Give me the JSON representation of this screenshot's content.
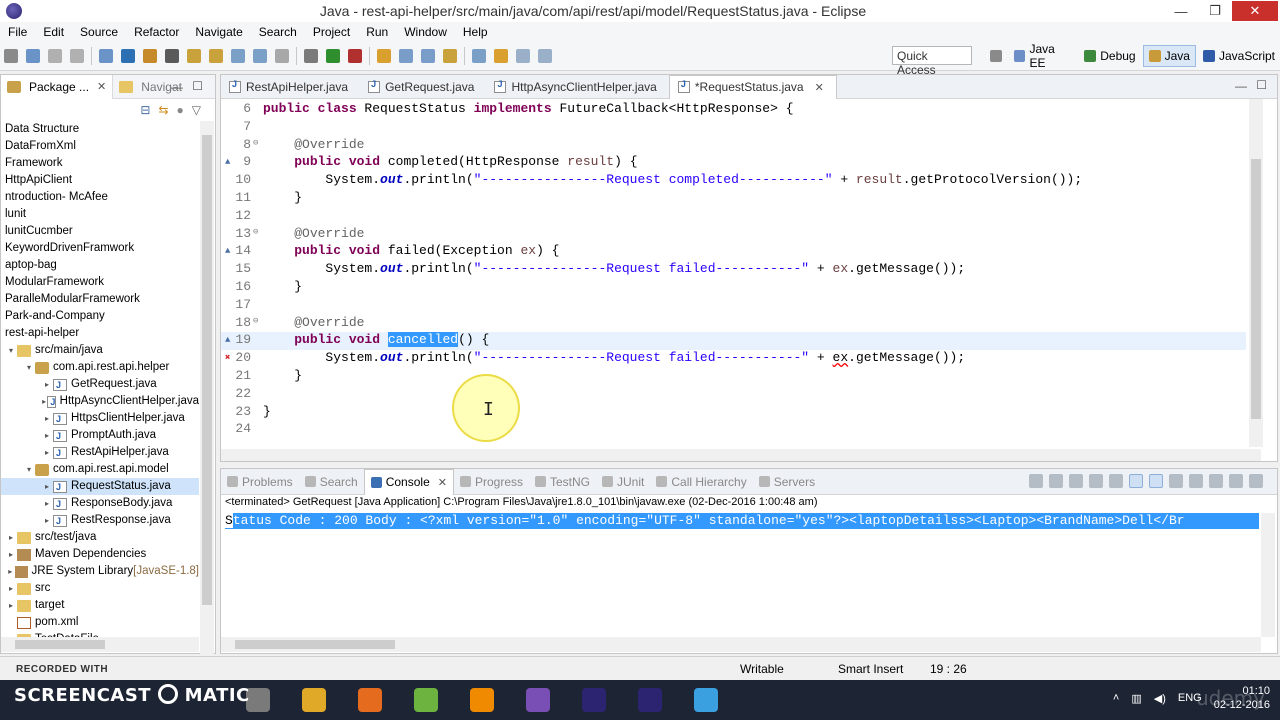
{
  "window": {
    "title": "Java - rest-api-helper/src/main/java/com/api/rest/api/model/RequestStatus.java - Eclipse",
    "minimize": "—",
    "restore": "❐",
    "close": "✕"
  },
  "menu": [
    "File",
    "Edit",
    "Source",
    "Refactor",
    "Navigate",
    "Search",
    "Project",
    "Run",
    "Window",
    "Help"
  ],
  "toolbar": {
    "quick_access": "Quick Access",
    "perspectives": [
      {
        "label": "Java EE",
        "color": "#6d8fc7"
      },
      {
        "label": "Debug",
        "color": "#3d8a3d"
      },
      {
        "label": "Java",
        "color": "#c89a3a",
        "active": true
      },
      {
        "label": "JavaScript",
        "color": "#2f5aa8"
      }
    ]
  },
  "left_pane": {
    "tabs": [
      "Package ...",
      "Navigat"
    ],
    "tree": [
      {
        "label": "Data Structure",
        "indent": 0,
        "icon": "none"
      },
      {
        "label": "DataFromXml",
        "indent": 0,
        "icon": "none"
      },
      {
        "label": "Framework",
        "indent": 0,
        "icon": "none"
      },
      {
        "label": "HttpApiClient",
        "indent": 0,
        "icon": "none"
      },
      {
        "label": "ntroduction- McAfee",
        "indent": 0,
        "icon": "none"
      },
      {
        "label": "lunit",
        "indent": 0,
        "icon": "none"
      },
      {
        "label": "lunitCucmber",
        "indent": 0,
        "icon": "none"
      },
      {
        "label": "KeywordDrivenFramwork",
        "indent": 0,
        "icon": "none"
      },
      {
        "label": "aptop-bag",
        "indent": 0,
        "icon": "none"
      },
      {
        "label": "ModularFramework",
        "indent": 0,
        "icon": "none"
      },
      {
        "label": "ParalleModularFramework",
        "indent": 0,
        "icon": "none"
      },
      {
        "label": "Park-and-Company",
        "indent": 0,
        "icon": "none"
      },
      {
        "label": "rest-api-helper",
        "indent": 0,
        "icon": "none"
      },
      {
        "label": "src/main/java",
        "indent": 1,
        "icon": "folder",
        "arrow": "▾"
      },
      {
        "label": "com.api.rest.api.helper",
        "indent": 2,
        "icon": "pkg",
        "arrow": "▾"
      },
      {
        "label": "GetRequest.java",
        "indent": 3,
        "icon": "java",
        "arrow": "▸"
      },
      {
        "label": "HttpAsyncClientHelper.java",
        "indent": 3,
        "icon": "java",
        "arrow": "▸"
      },
      {
        "label": "HttpsClientHelper.java",
        "indent": 3,
        "icon": "java",
        "arrow": "▸"
      },
      {
        "label": "PromptAuth.java",
        "indent": 3,
        "icon": "java",
        "arrow": "▸"
      },
      {
        "label": "RestApiHelper.java",
        "indent": 3,
        "icon": "java",
        "arrow": "▸"
      },
      {
        "label": "com.api.rest.api.model",
        "indent": 2,
        "icon": "pkg",
        "arrow": "▾"
      },
      {
        "label": "RequestStatus.java",
        "indent": 3,
        "icon": "java",
        "arrow": "▸",
        "selected": true
      },
      {
        "label": "ResponseBody.java",
        "indent": 3,
        "icon": "java",
        "arrow": "▸"
      },
      {
        "label": "RestResponse.java",
        "indent": 3,
        "icon": "java",
        "arrow": "▸"
      },
      {
        "label": "src/test/java",
        "indent": 1,
        "icon": "folder",
        "arrow": "▸"
      },
      {
        "label": "Maven Dependencies",
        "indent": 1,
        "icon": "lib",
        "arrow": "▸"
      },
      {
        "label": "JRE System Library",
        "suffix": " [JavaSE-1.8]",
        "indent": 1,
        "icon": "lib",
        "arrow": "▸"
      },
      {
        "label": "src",
        "indent": 1,
        "icon": "folder",
        "arrow": "▸"
      },
      {
        "label": "target",
        "indent": 1,
        "icon": "folder",
        "arrow": "▸"
      },
      {
        "label": "pom.xml",
        "indent": 1,
        "icon": "xml",
        "arrow": ""
      },
      {
        "label": "TestDataFile",
        "indent": 1,
        "icon": "folder",
        "arrow": ""
      }
    ]
  },
  "editor": {
    "tabs": [
      {
        "label": "RestApiHelper.java"
      },
      {
        "label": "GetRequest.java"
      },
      {
        "label": "HttpAsyncClientHelper.java"
      },
      {
        "label": "*RequestStatus.java",
        "active": true
      }
    ],
    "lines": [
      {
        "n": "6",
        "src": [
          [
            "kw",
            "public "
          ],
          [
            "kw",
            "class "
          ],
          [
            "",
            "RequestStatus "
          ],
          [
            "kw",
            "implements "
          ],
          [
            "",
            "FutureCallback<HttpResponse> {"
          ]
        ]
      },
      {
        "n": "7",
        "src": []
      },
      {
        "n": "8",
        "fold": "⊖",
        "src": [
          [
            "",
            "    "
          ],
          [
            "an",
            "@Override"
          ]
        ]
      },
      {
        "n": "9",
        "ann": "▲",
        "src": [
          [
            "",
            "    "
          ],
          [
            "kw",
            "public "
          ],
          [
            "kw",
            "void "
          ],
          [
            "",
            "completed(HttpResponse "
          ],
          [
            "par",
            "result"
          ],
          [
            "",
            ") {"
          ]
        ]
      },
      {
        "n": "10",
        "src": [
          [
            "",
            "        System."
          ],
          [
            "fld",
            "out"
          ],
          [
            "",
            ".println("
          ],
          [
            "str",
            "\"----------------Request completed-----------\""
          ],
          [
            "",
            " + "
          ],
          [
            "par",
            "result"
          ],
          [
            "",
            ".getProtocolVersion());"
          ]
        ]
      },
      {
        "n": "11",
        "src": [
          [
            "",
            "    }"
          ]
        ]
      },
      {
        "n": "12",
        "src": []
      },
      {
        "n": "13",
        "fold": "⊖",
        "src": [
          [
            "",
            "    "
          ],
          [
            "an",
            "@Override"
          ]
        ]
      },
      {
        "n": "14",
        "ann": "▲",
        "src": [
          [
            "",
            "    "
          ],
          [
            "kw",
            "public "
          ],
          [
            "kw",
            "void "
          ],
          [
            "",
            "failed(Exception "
          ],
          [
            "par",
            "ex"
          ],
          [
            "",
            ") {"
          ]
        ]
      },
      {
        "n": "15",
        "src": [
          [
            "",
            "        System."
          ],
          [
            "fld",
            "out"
          ],
          [
            "",
            ".println("
          ],
          [
            "str",
            "\"----------------Request failed-----------\""
          ],
          [
            "",
            " + "
          ],
          [
            "par",
            "ex"
          ],
          [
            "",
            ".getMessage());"
          ]
        ]
      },
      {
        "n": "16",
        "src": [
          [
            "",
            "    }"
          ]
        ]
      },
      {
        "n": "17",
        "src": []
      },
      {
        "n": "18",
        "fold": "⊖",
        "src": [
          [
            "",
            "    "
          ],
          [
            "an",
            "@Override"
          ]
        ]
      },
      {
        "n": "19",
        "ann": "▲",
        "current": true,
        "src": [
          [
            "",
            "    "
          ],
          [
            "kw",
            "public "
          ],
          [
            "kw",
            "void "
          ],
          [
            "hl",
            "cancelled"
          ],
          [
            "",
            "() {"
          ]
        ]
      },
      {
        "n": "20",
        "ann": "✖",
        "src": [
          [
            "",
            "        System."
          ],
          [
            "fld",
            "out"
          ],
          [
            "",
            ".println("
          ],
          [
            "str",
            "\"----------------Request failed-----------\""
          ],
          [
            "",
            " + "
          ],
          [
            "err",
            "ex"
          ],
          [
            "",
            ".getMessage());"
          ]
        ]
      },
      {
        "n": "21",
        "src": [
          [
            "",
            "    }"
          ]
        ]
      },
      {
        "n": "22",
        "src": []
      },
      {
        "n": "23",
        "src": [
          [
            "",
            "}"
          ]
        ]
      },
      {
        "n": "24",
        "src": []
      }
    ]
  },
  "console": {
    "tabs": [
      {
        "label": "Problems"
      },
      {
        "label": "Search"
      },
      {
        "label": "Console",
        "active": true
      },
      {
        "label": "Progress"
      },
      {
        "label": "TestNG"
      },
      {
        "label": "JUnit"
      },
      {
        "label": "Call Hierarchy"
      },
      {
        "label": "Servers"
      }
    ],
    "terminated": "<terminated> GetRequest [Java Application] C:\\Program Files\\Java\\jre1.8.0_101\\bin\\javaw.exe (02-Dec-2016 1:00:48 am)",
    "output_first": "S",
    "output_rest": "tatus Code : 200 Body : <?xml version=\"1.0\" encoding=\"UTF-8\" standalone=\"yes\"?><laptopDetailss><Laptop><BrandName>Dell</Br"
  },
  "status": {
    "writable": "Writable",
    "insert_mode": "Smart Insert",
    "position": "19 : 26",
    "recorded_with": "RECORDED WITH"
  },
  "taskbar": {
    "screencast": "SCREENCAST",
    "matic": "MATIC",
    "apps": [
      {
        "name": "settings",
        "color": "#7a7a7a"
      },
      {
        "name": "chrome",
        "color": "#e0a928"
      },
      {
        "name": "firefox",
        "color": "#e56b1f"
      },
      {
        "name": "editor",
        "color": "#6cb33f"
      },
      {
        "name": "vlc",
        "color": "#f08a00"
      },
      {
        "name": "visual-studio",
        "color": "#7a4fb5"
      },
      {
        "name": "eclipse",
        "color": "#2c2470"
      },
      {
        "name": "eclipse-2",
        "color": "#2c2470"
      },
      {
        "name": "record",
        "color": "#3aa0e0"
      }
    ],
    "lang": "ENG",
    "time": "01:10",
    "date": "02-12-2016",
    "watermark": "udemy"
  }
}
